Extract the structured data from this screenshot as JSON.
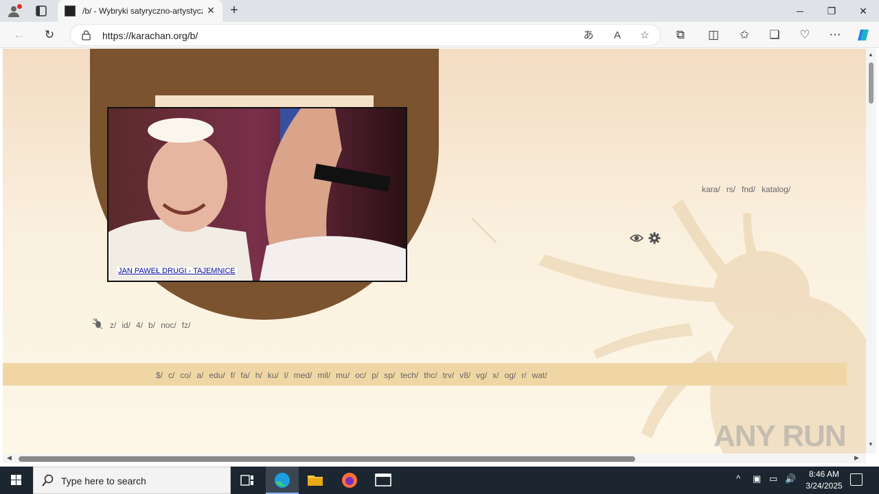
{
  "browser": {
    "tab_title": "/b/ - Wybryki satyryczno-artystyczne",
    "tab_close": "✕",
    "new_tab": "+",
    "url": "https://karachan.org/b/",
    "window_controls": {
      "minimize": "─",
      "maximize": "❐",
      "close": "✕"
    }
  },
  "page": {
    "banner_caption": "JAN PAWEŁ DRUGI - TAJEMNICE",
    "top_boards": [
      "kara/",
      "rs/",
      "fnd/",
      "katalog/"
    ],
    "mid_boards": [
      "z/",
      "id/",
      "4/",
      "b/",
      "noc/",
      "fz/"
    ],
    "board_bar": [
      "$/",
      "c/",
      "co/",
      "a/",
      "edu/",
      "f/",
      "fa/",
      "h/",
      "ku/",
      "l/",
      "med/",
      "mil/",
      "mu/",
      "oc/",
      "p/",
      "sp/",
      "tech/",
      "thc/",
      "trv/",
      "v8/",
      "vg/",
      "x/",
      "og/",
      "r/",
      "wat/"
    ],
    "watermark": "ANY RUN"
  },
  "taskbar": {
    "search_placeholder": "Type here to search",
    "time": "8:46 AM",
    "date": "3/24/2025"
  },
  "colors": {
    "banner_brown": "#7b532f",
    "board_bar": "#f0d6a4",
    "link": "#666666"
  }
}
